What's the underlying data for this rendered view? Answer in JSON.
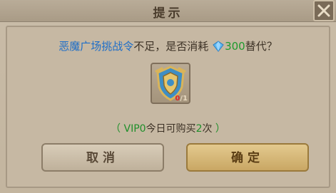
{
  "dialog": {
    "title": "提示",
    "message": {
      "item_name": "恶魔广场挑战令",
      "middle": "不足，是否消耗",
      "cost": "300",
      "suffix": "替代？"
    },
    "item": {
      "icon": "shield-token-icon",
      "owned": "0",
      "required": "/1"
    },
    "vip": {
      "open": "（ ",
      "level": "VIP0",
      "middle": "今日可购买",
      "count": "2",
      "unit": "次",
      "close": " ）"
    },
    "buttons": {
      "cancel": "取消",
      "confirm": "确定"
    },
    "colors": {
      "highlight_blue": "#1e6ec8",
      "highlight_green": "#1f9a2e",
      "shortage_red": "#e02424"
    }
  }
}
